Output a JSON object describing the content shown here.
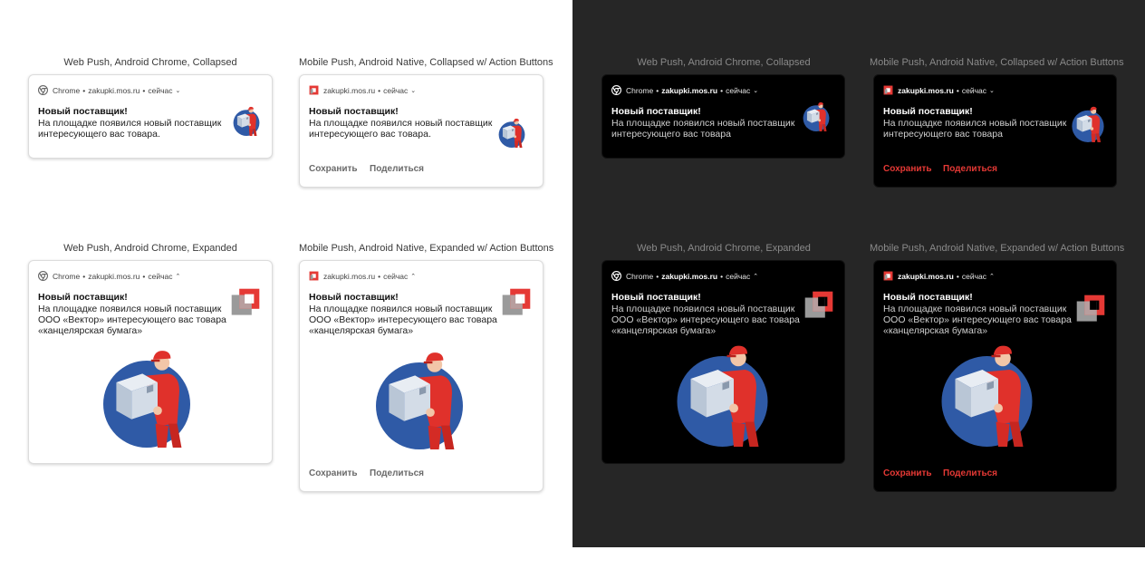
{
  "captions": {
    "web_collapsed": "Web Push, Android Chrome, Collapsed",
    "mobile_collapsed": "Mobile Push, Android Native, Collapsed w/ Action Buttons",
    "web_expanded": "Web Push, Android Chrome, Expanded",
    "mobile_expanded": "Mobile Push, Android Native, Expanded w/ Action Buttons"
  },
  "header": {
    "browser": "Chrome",
    "site": "zakupki.mos.ru",
    "sep": "•",
    "time": "сейчас",
    "chevron_down": "⌄",
    "chevron_up": "⌃"
  },
  "notification": {
    "title": "Новый поставщик!",
    "body_short": "На площадке появился новый поставщик\nинтересующего вас товара.",
    "body_short_dark": "На площадке появился новый поставщик\nинтересующего вас товара",
    "body_long": "На площадке появился новый поставщик\nООО «Вектор» интересующего вас товара\n«канцелярская бумага»"
  },
  "actions": {
    "save": "Сохранить",
    "share": "Поделиться"
  },
  "colors": {
    "brand_red": "#e53935",
    "illustration_blue": "#2f5aa6",
    "dark_panel": "#262626"
  },
  "icons": {
    "browser": "chrome-icon",
    "app": "mos-logo-icon",
    "illustration": "courier-with-box"
  }
}
